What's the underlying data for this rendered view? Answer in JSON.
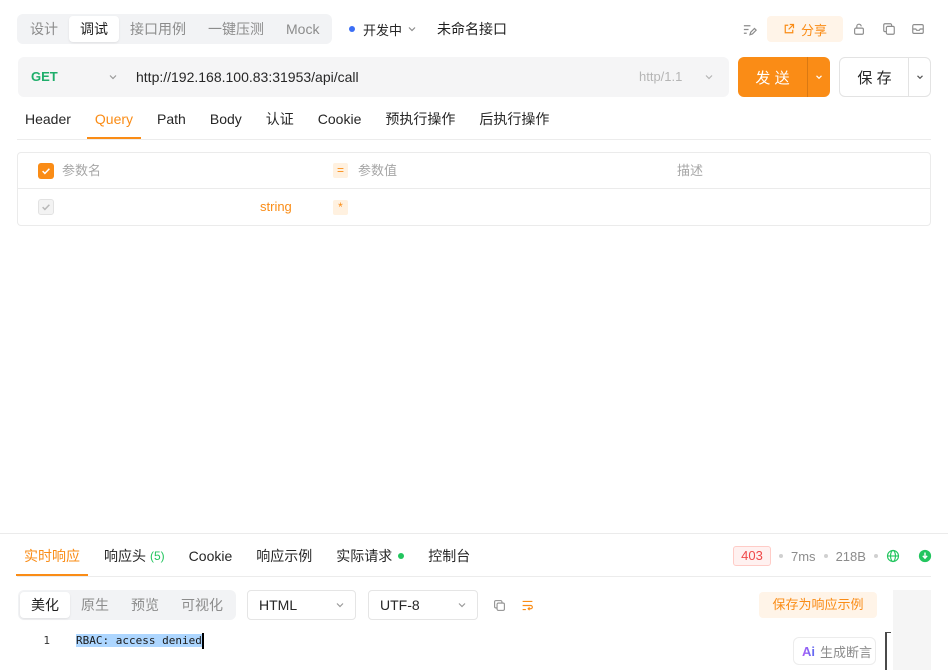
{
  "theme": {
    "accent": "#fa8c16",
    "accent_soft": "#fff4e8",
    "method_get": "#1fae6b",
    "success": "#22c55e",
    "error": "#f04848",
    "status_dot": "#3b6ef5"
  },
  "header": {
    "mode_tabs": [
      {
        "label": "设计",
        "active": false
      },
      {
        "label": "调试",
        "active": true
      },
      {
        "label": "接口用例",
        "active": false
      },
      {
        "label": "一键压测",
        "active": false
      },
      {
        "label": "Mock",
        "active": false
      }
    ],
    "status": {
      "label": "开发中",
      "icon": "chevron-down-icon"
    },
    "api_name": "未命名接口",
    "share": {
      "label": "分享",
      "icon": "share-icon"
    },
    "toolbar_icons": [
      "format-icon",
      "lock-icon",
      "copy-icon",
      "archive-icon"
    ]
  },
  "request": {
    "method": "GET",
    "url": "http://192.168.100.83:31953/api/call",
    "protocol": "http/1.1",
    "send_label": "发 送",
    "save_label": "保 存"
  },
  "request_tabs": [
    {
      "label": "Header",
      "active": false
    },
    {
      "label": "Query",
      "active": true
    },
    {
      "label": "Path",
      "active": false
    },
    {
      "label": "Body",
      "active": false
    },
    {
      "label": "认证",
      "active": false
    },
    {
      "label": "Cookie",
      "active": false
    },
    {
      "label": "预执行操作",
      "active": false
    },
    {
      "label": "后执行操作",
      "active": false
    }
  ],
  "params": {
    "all_checked": true,
    "columns": {
      "name": "参数名",
      "equals": "=",
      "value": "参数值",
      "description": "描述"
    },
    "rows": [
      {
        "checked": true,
        "disabled": true,
        "type": "string",
        "required_mark": "*"
      }
    ]
  },
  "response": {
    "tabs": [
      {
        "label": "实时响应",
        "active": true
      },
      {
        "label": "响应头",
        "count": "(5)",
        "active": false
      },
      {
        "label": "Cookie",
        "active": false
      },
      {
        "label": "响应示例",
        "active": false
      },
      {
        "label": "实际请求",
        "active": false,
        "has_dot": true
      },
      {
        "label": "控制台",
        "active": false
      }
    ],
    "status_code": "403",
    "time": "7ms",
    "size": "218B",
    "status_icons": [
      "globe-icon",
      "download-circle-icon"
    ],
    "view_tabs": [
      {
        "label": "美化",
        "active": true
      },
      {
        "label": "原生",
        "active": false
      },
      {
        "label": "预览",
        "active": false
      },
      {
        "label": "可视化",
        "active": false
      }
    ],
    "format": "HTML",
    "encoding": "UTF-8",
    "tool_icons": [
      "copy-icon",
      "wrap-lines-icon"
    ],
    "save_example_label": "保存为响应示例",
    "body_lines": [
      {
        "number": "1",
        "text": "RBAC: access denied",
        "selected": true
      }
    ],
    "ai_assert": {
      "badge": "Ai",
      "label": "生成断言"
    }
  }
}
